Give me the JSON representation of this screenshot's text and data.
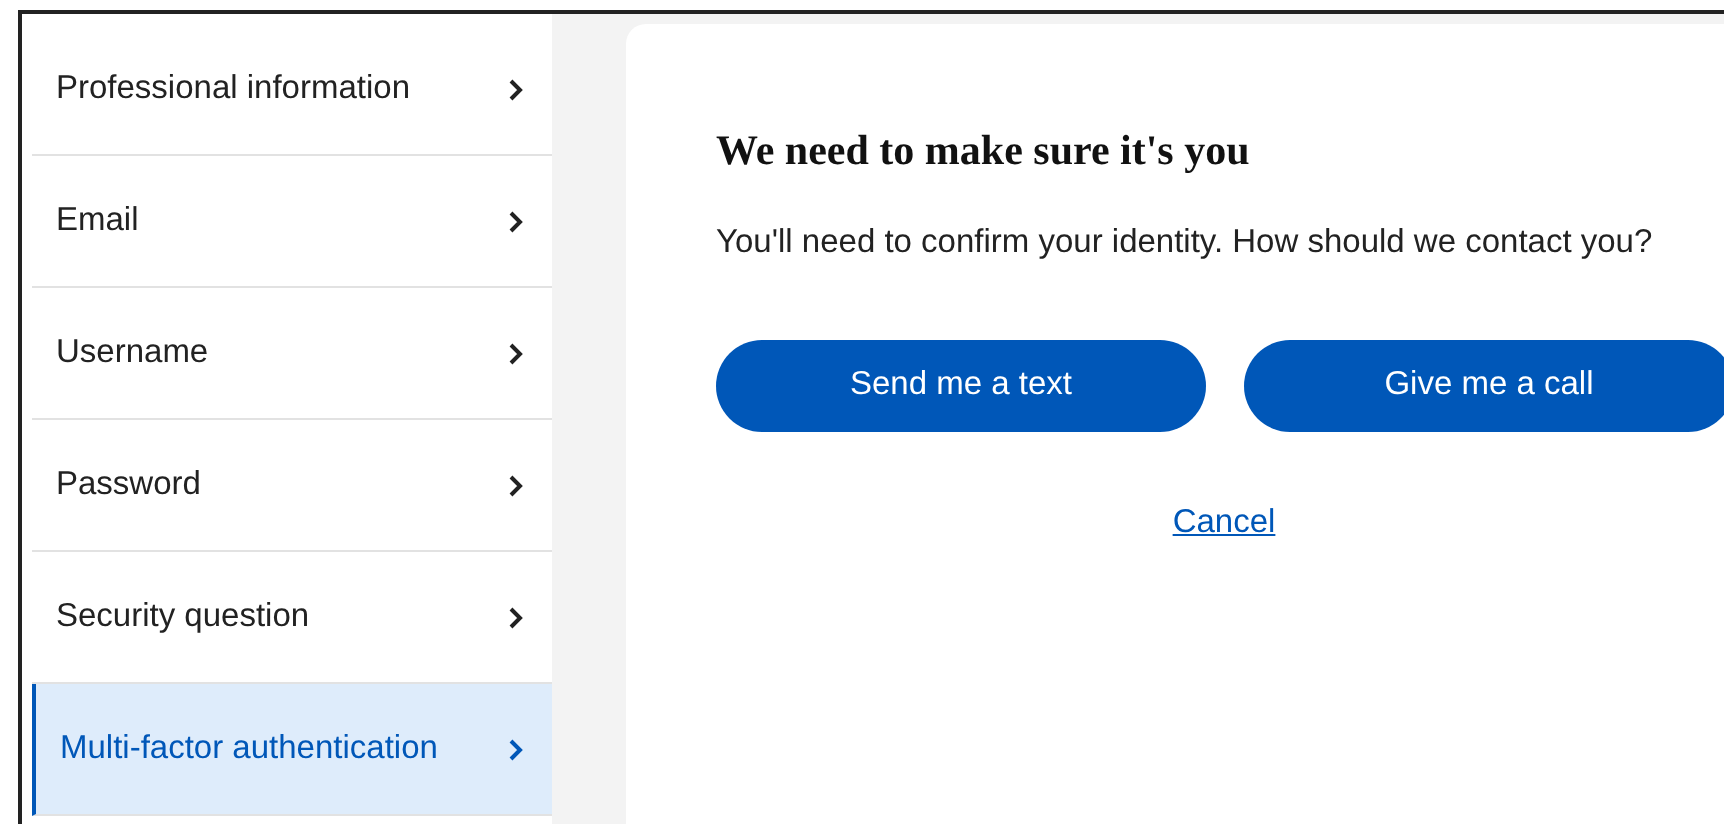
{
  "sidebar": {
    "items": [
      {
        "label": "Professional information",
        "selected": false
      },
      {
        "label": "Email",
        "selected": false
      },
      {
        "label": "Username",
        "selected": false
      },
      {
        "label": "Password",
        "selected": false
      },
      {
        "label": "Security question",
        "selected": false
      },
      {
        "label": "Multi-factor authentication",
        "selected": true
      }
    ]
  },
  "dialog": {
    "title": "We need to make sure it's you",
    "message": "You'll need to confirm your identity. How should we contact you?",
    "buttons": [
      "Send me a text",
      "Give me a call"
    ],
    "cancel": "Cancel"
  }
}
